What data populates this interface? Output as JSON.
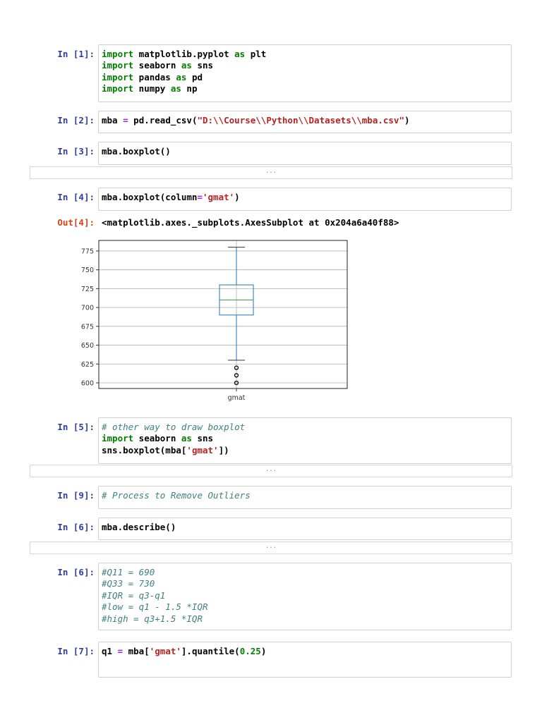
{
  "cells": [
    {
      "prompt": "In [1]:",
      "lines": [
        [
          {
            "t": "import",
            "c": "kw"
          },
          {
            "t": " matplotlib.pyplot "
          },
          {
            "t": "as",
            "c": "kw"
          },
          {
            "t": " plt"
          }
        ],
        [
          {
            "t": "import",
            "c": "kw"
          },
          {
            "t": " seaborn "
          },
          {
            "t": "as",
            "c": "kw"
          },
          {
            "t": " sns"
          }
        ],
        [
          {
            "t": "import",
            "c": "kw"
          },
          {
            "t": " pandas "
          },
          {
            "t": "as",
            "c": "kw"
          },
          {
            "t": " pd"
          }
        ],
        [
          {
            "t": "import",
            "c": "kw"
          },
          {
            "t": " numpy "
          },
          {
            "t": "as",
            "c": "kw"
          },
          {
            "t": " np"
          }
        ]
      ]
    },
    {
      "prompt": "In [2]:",
      "lines": [
        [
          {
            "t": "mba "
          },
          {
            "t": "=",
            "c": "op"
          },
          {
            "t": " pd.read_csv("
          },
          {
            "t": "\"D:\\\\Course\\\\Python\\\\Datasets\\\\mba.csv\"",
            "c": "str"
          },
          {
            "t": ")"
          }
        ]
      ]
    },
    {
      "prompt": "In [3]:",
      "lines": [
        [
          {
            "t": "mba.boxplot()"
          }
        ]
      ],
      "collapsed": "..."
    },
    {
      "prompt": "In [4]:",
      "lines": [
        [
          {
            "t": "mba.boxplot(column"
          },
          {
            "t": "=",
            "c": "op"
          },
          {
            "t": "'gmat'",
            "c": "str"
          },
          {
            "t": ")"
          }
        ]
      ],
      "out_prompt": "Out[4]:",
      "out_text": "<matplotlib.axes._subplots.AxesSubplot at 0x204a6a40f88>"
    },
    {
      "prompt": "In [5]:",
      "lines": [
        [
          {
            "t": "# other way to draw boxplot",
            "c": "cm"
          }
        ],
        [
          {
            "t": "import",
            "c": "kw"
          },
          {
            "t": " seaborn "
          },
          {
            "t": "as",
            "c": "kw"
          },
          {
            "t": " sns"
          }
        ],
        [
          {
            "t": "sns.boxplot(mba["
          },
          {
            "t": "'gmat'",
            "c": "str"
          },
          {
            "t": "])"
          }
        ]
      ],
      "collapsed": "..."
    },
    {
      "prompt": "In [9]:",
      "lines": [
        [
          {
            "t": "# Process to Remove Outliers",
            "c": "cm"
          }
        ]
      ]
    },
    {
      "prompt": "In [6]:",
      "lines": [
        [
          {
            "t": "mba.describe()"
          }
        ]
      ],
      "collapsed": "..."
    },
    {
      "prompt": "In [6]:",
      "lines": [
        [
          {
            "t": "#Q11 = 690",
            "c": "cm"
          }
        ],
        [
          {
            "t": "#Q33 = 730",
            "c": "cm"
          }
        ],
        [
          {
            "t": "#IQR = q3-q1",
            "c": "cm"
          }
        ],
        [
          {
            "t": "#low = q1 - 1.5 *IQR",
            "c": "cm"
          }
        ],
        [
          {
            "t": "#high = q3+1.5 *IQR",
            "c": "cm"
          }
        ]
      ]
    },
    {
      "prompt": "In [7]:",
      "lines": [
        [
          {
            "t": "q1 "
          },
          {
            "t": "=",
            "c": "op"
          },
          {
            "t": " mba["
          },
          {
            "t": "'gmat'",
            "c": "str"
          },
          {
            "t": "].quantile("
          },
          {
            "t": "0.25",
            "c": "num"
          },
          {
            "t": ")"
          }
        ]
      ]
    }
  ],
  "chart_data": {
    "type": "box",
    "categories": [
      "gmat"
    ],
    "series": [
      {
        "name": "gmat",
        "whisker_low": 630,
        "q1": 690,
        "median": 710,
        "q3": 730,
        "whisker_high": 780,
        "outliers": [
          600,
          610,
          620
        ]
      }
    ],
    "yticks": [
      600,
      625,
      650,
      675,
      700,
      725,
      750,
      775
    ],
    "ylim": [
      592.5,
      789
    ],
    "grid": true,
    "colors": {
      "box": "#1f77b4",
      "median": "#2ca02c",
      "outlier": "#000000",
      "grid": "#b0b0b0"
    }
  }
}
